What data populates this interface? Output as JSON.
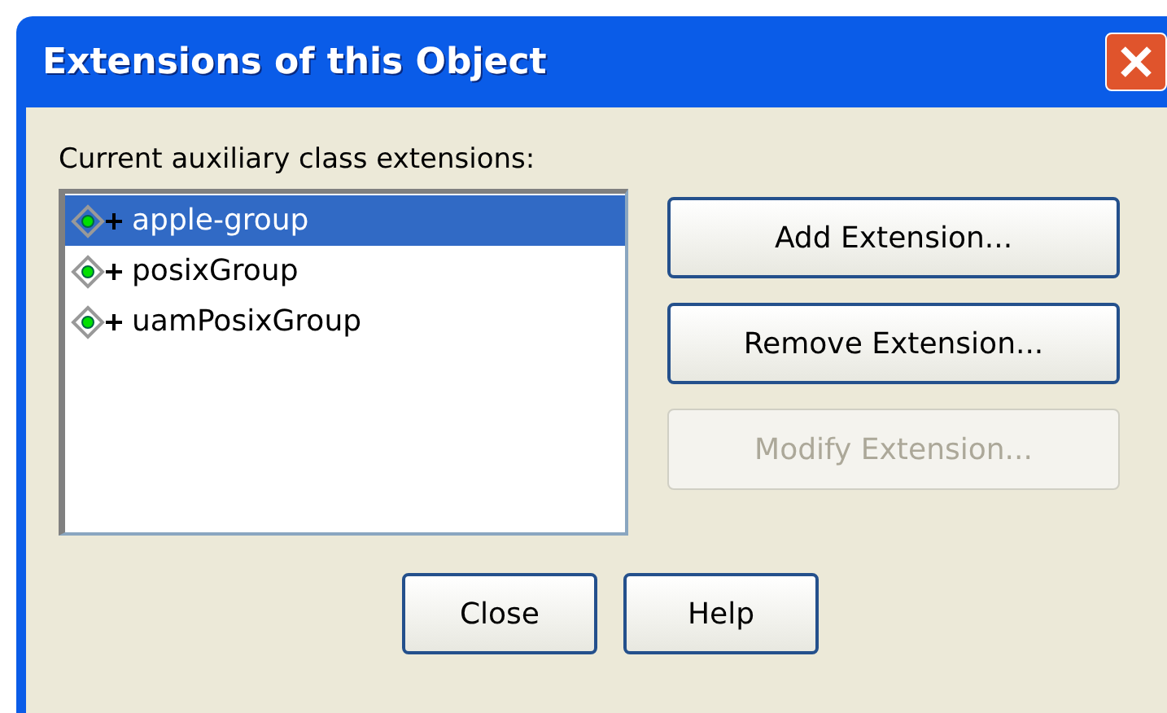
{
  "window": {
    "title": "Extensions of this Object"
  },
  "label": "Current auxiliary class extensions:",
  "extensions": [
    {
      "name": "apple-group",
      "selected": true
    },
    {
      "name": "posixGroup",
      "selected": false
    },
    {
      "name": "uamPosixGroup",
      "selected": false
    }
  ],
  "side_buttons": [
    {
      "label": "Add Extension...",
      "disabled": false
    },
    {
      "label": "Remove Extension...",
      "disabled": false
    },
    {
      "label": "Modify Extension...",
      "disabled": true
    }
  ],
  "buttons": [
    {
      "label": "Close"
    },
    {
      "label": "Help"
    }
  ]
}
